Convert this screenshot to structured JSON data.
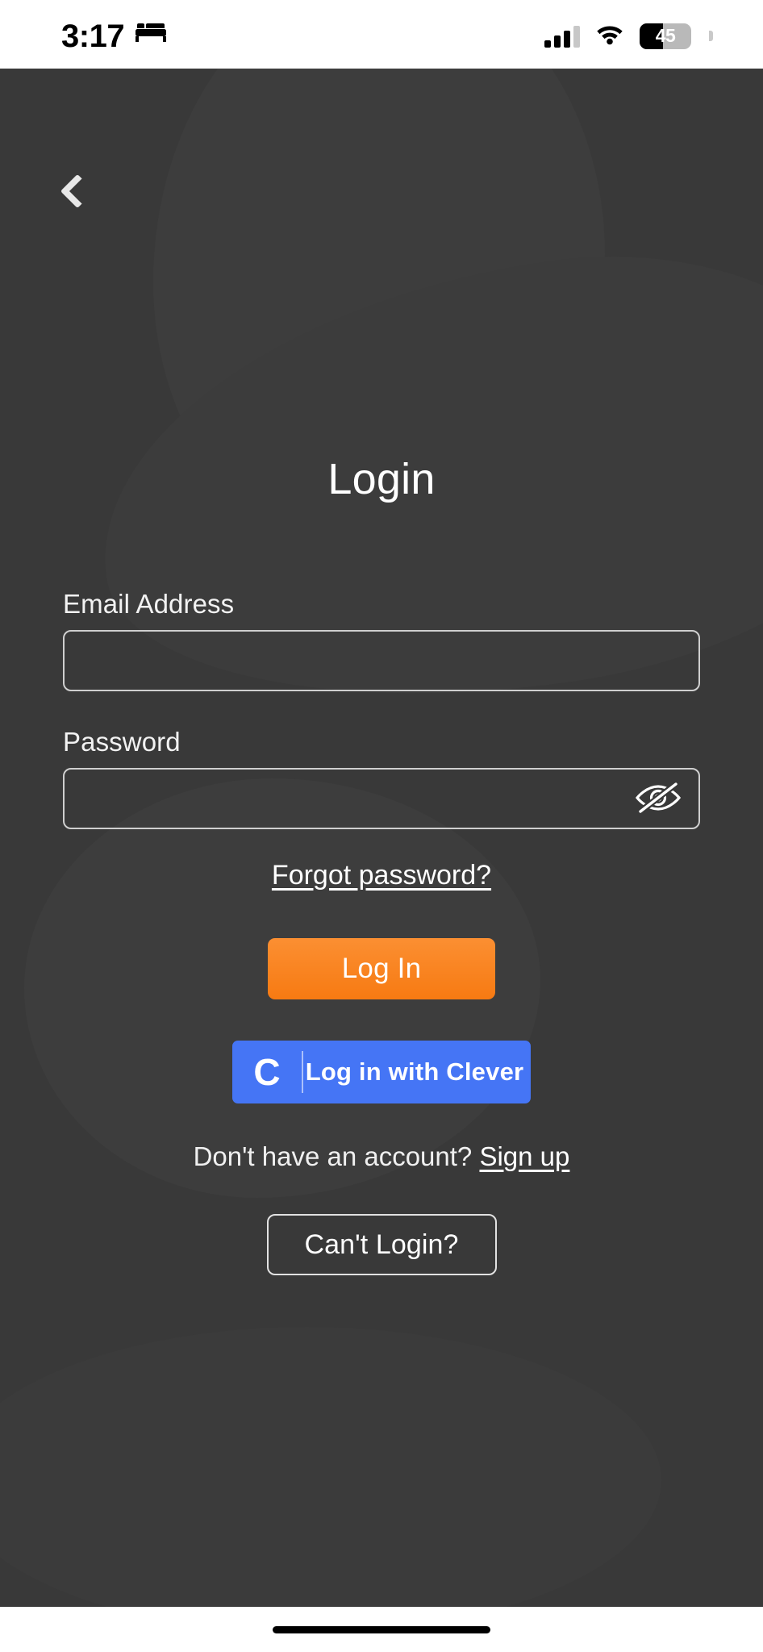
{
  "status_bar": {
    "time": "3:17",
    "sleep_icon": "bed-icon",
    "cellular_icon": "signal-bars-icon",
    "wifi_icon": "wifi-icon",
    "battery_level": "45",
    "battery_percent": 45
  },
  "screen": {
    "back_icon": "chevron-left-icon",
    "title": "Login"
  },
  "form": {
    "email": {
      "label": "Email Address",
      "value": "",
      "placeholder": ""
    },
    "password": {
      "label": "Password",
      "value": "",
      "placeholder": "",
      "toggle_icon": "eye-slash-icon",
      "visible": false
    },
    "forgot_link": "Forgot password?"
  },
  "actions": {
    "login_label": "Log In",
    "login_color": "#f77a12",
    "clever_label": "Log in with Clever",
    "clever_logo": "C",
    "clever_color": "#4575f5",
    "signup_prompt": "Don't have an account?",
    "signup_link": "Sign up",
    "cant_login_label": "Can't Login?"
  },
  "system": {
    "home_indicator": "home-indicator"
  }
}
